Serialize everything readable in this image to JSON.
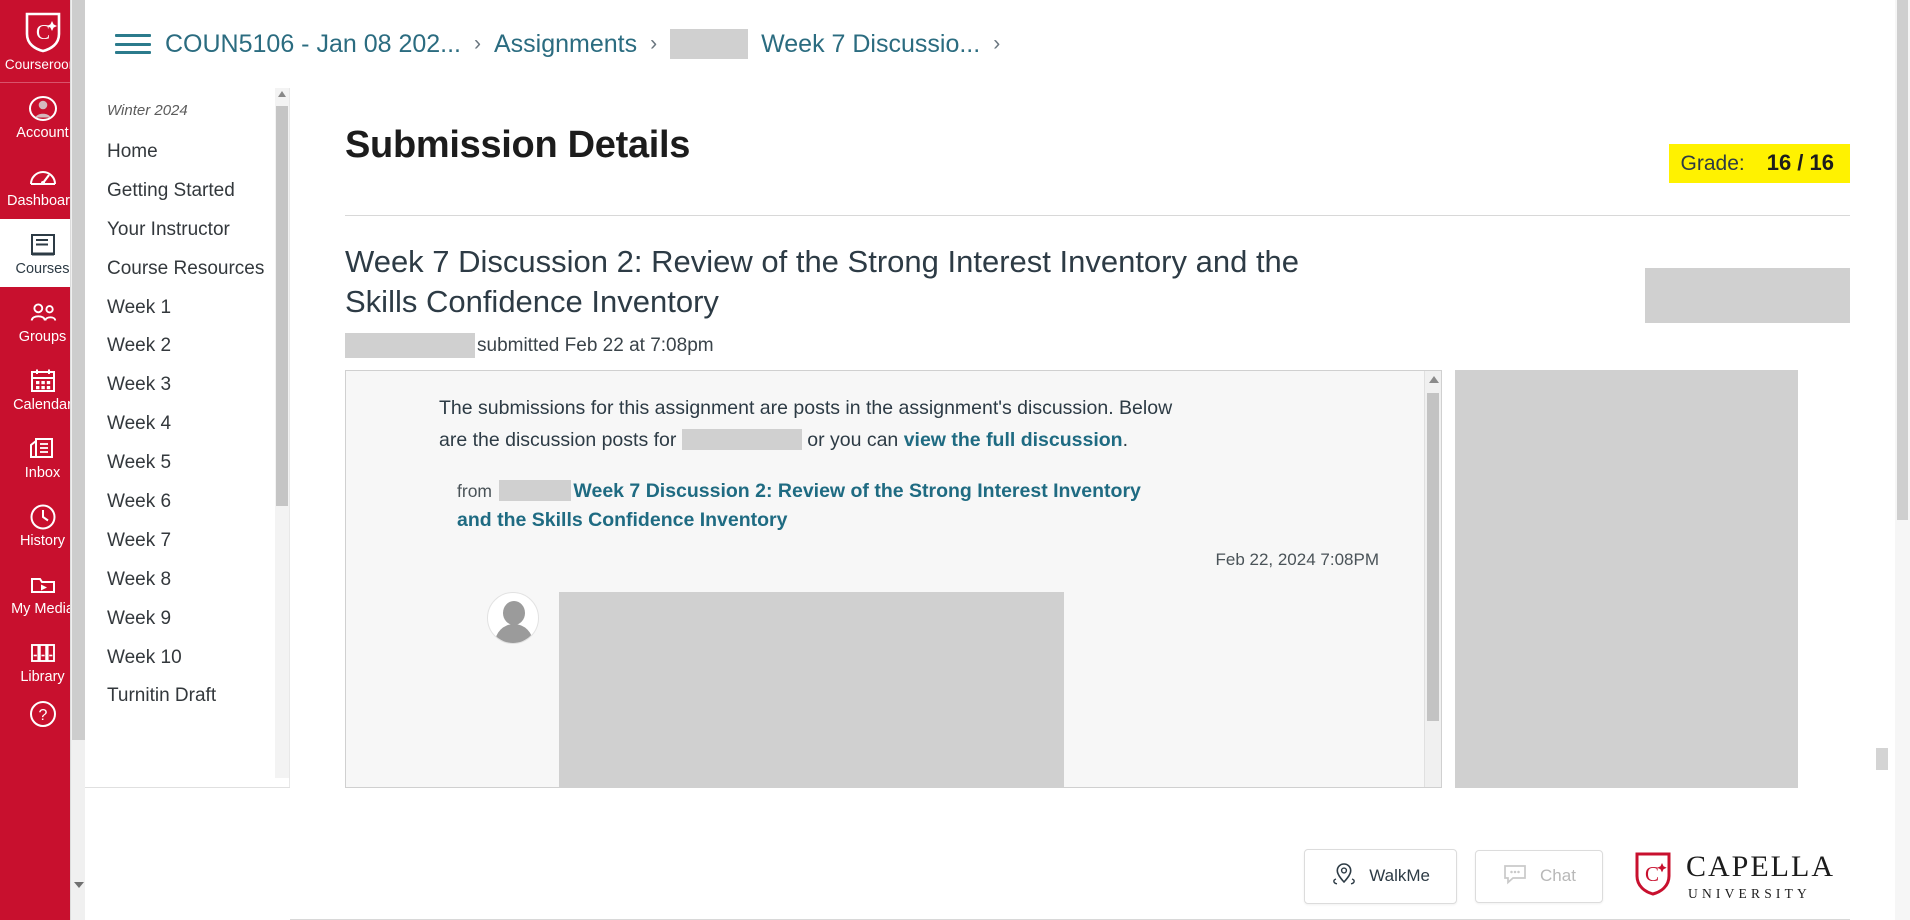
{
  "global_nav": {
    "logo": {
      "icon": "capella-shield-icon",
      "label": "Courseroom"
    },
    "items": [
      {
        "label": "Account",
        "icon": "account-avatar-icon",
        "active": false
      },
      {
        "label": "Dashboard",
        "icon": "dashboard-gauge-icon",
        "active": false
      },
      {
        "label": "Courses",
        "icon": "courses-book-icon",
        "active": true
      },
      {
        "label": "Groups",
        "icon": "groups-people-icon",
        "active": false
      },
      {
        "label": "Calendar",
        "icon": "calendar-icon",
        "active": false
      },
      {
        "label": "Inbox",
        "icon": "inbox-tray-icon",
        "active": false
      },
      {
        "label": "History",
        "icon": "history-clock-icon",
        "active": false
      },
      {
        "label": "My Media",
        "icon": "my-media-play-icon",
        "active": false
      },
      {
        "label": "Library",
        "icon": "library-books-icon",
        "active": false
      }
    ],
    "help": {
      "icon": "help-question-icon",
      "label": "?"
    }
  },
  "breadcrumb": {
    "menu_icon": "hamburger-menu-icon",
    "items": [
      {
        "label": "COUN5106 - Jan 08 202...",
        "redacted": false
      },
      {
        "label": "Assignments",
        "redacted": false
      },
      {
        "label": "Week 7 Discussio...",
        "redacted": true
      }
    ],
    "separator": "›"
  },
  "course_nav": {
    "term": "Winter 2024",
    "items": [
      "Home",
      "Getting Started",
      "Your Instructor",
      "Course Resources",
      "Week 1",
      "Week 2",
      "Week 3",
      "Week 4",
      "Week 5",
      "Week 6",
      "Week 7",
      "Week 8",
      "Week 9",
      "Week 10",
      "Turnitin Draft"
    ]
  },
  "page": {
    "title": "Submission Details",
    "grade_label": "Grade:",
    "grade_value": "16 / 16",
    "grade_highlight_color": "#FFF200"
  },
  "assignment": {
    "title": "Week 7 Discussion 2: Review of the Strong Interest Inventory and the Skills Confidence Inventory",
    "submitted_text": "submitted Feb 22 at 7:08pm"
  },
  "discussion": {
    "intro_part1": "The submissions for this assignment are posts in the assignment's discussion. Below are the discussion posts for",
    "intro_part2": "or you can",
    "full_discussion_link": "view the full discussion",
    "intro_end": ".",
    "from_word": "from",
    "topic_link": "Week 7 Discussion 2: Review of the Strong Interest Inventory and the Skills Confidence Inventory",
    "post_date": "Feb 22, 2024 7:08PM",
    "avatar_icon": "default-user-avatar-icon"
  },
  "footer": {
    "walkme": {
      "label": "WalkMe",
      "icon": "walkme-pin-icon"
    },
    "chat": {
      "label": "Chat",
      "icon": "chat-bubble-icon",
      "disabled": true
    },
    "brand": {
      "name": "CAPELLA",
      "subtitle": "UNIVERSITY",
      "icon": "capella-shield-icon"
    }
  }
}
